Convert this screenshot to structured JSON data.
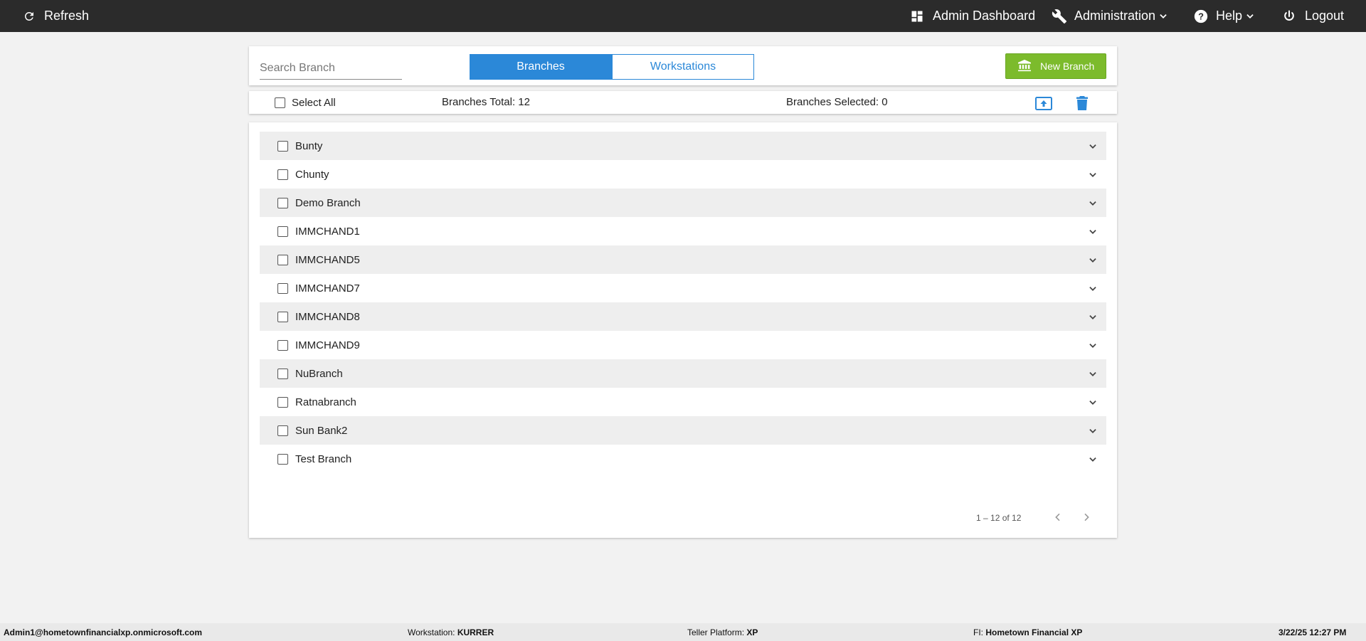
{
  "topbar": {
    "refresh_label": "Refresh",
    "admin_dashboard_label": "Admin Dashboard",
    "administration_label": "Administration",
    "help_label": "Help",
    "logout_label": "Logout"
  },
  "toolbar": {
    "search_placeholder": "Search Branch",
    "search_value": "",
    "tabs": [
      "Branches",
      "Workstations"
    ],
    "active_tab": "Branches",
    "new_branch_label": "New Branch"
  },
  "selection": {
    "select_all_label": "Select All",
    "total_text": "Branches Total: 12",
    "selected_text": "Branches Selected: 0"
  },
  "branches": [
    "Bunty",
    "Chunty",
    "Demo Branch",
    "IMMCHAND1",
    "IMMCHAND5",
    "IMMCHAND7",
    "IMMCHAND8",
    "IMMCHAND9",
    "NuBranch",
    "Ratnabranch",
    "Sun Bank2",
    "Test Branch"
  ],
  "pagination": {
    "range_text": "1 – 12 of 12"
  },
  "footer": {
    "user": "Admin1@hometownfinancialxp.onmicrosoft.com",
    "workstation_label": "Workstation:",
    "workstation_value": "KURRER",
    "teller_platform_label": "Teller Platform:",
    "teller_platform_value": "XP",
    "fi_label": "FI:",
    "fi_value": "Hometown Financial XP",
    "datetime": "3/22/25 12:27 PM"
  },
  "colors": {
    "topbar_bg": "#2b2b2b",
    "accent_blue": "#2b88d8",
    "new_branch_green": "#7cbb2c",
    "page_bg": "#f2f2f2"
  }
}
